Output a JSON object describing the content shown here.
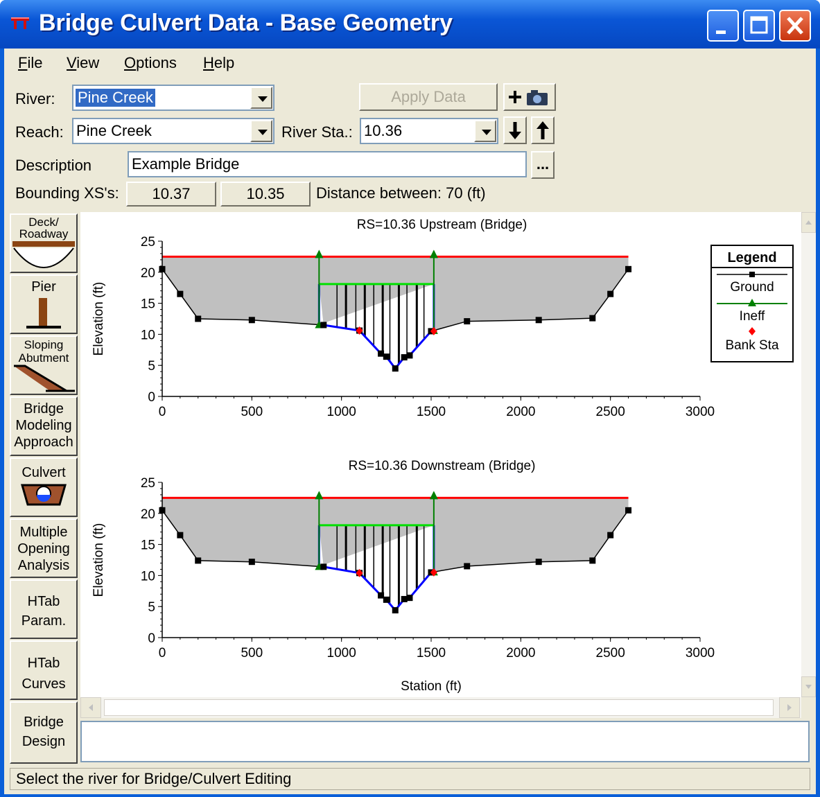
{
  "window": {
    "title": "Bridge Culvert Data - Base Geometry"
  },
  "menu": [
    {
      "label": "File",
      "mnemonic": "F"
    },
    {
      "label": "View",
      "mnemonic": "V"
    },
    {
      "label": "Options",
      "mnemonic": "O"
    },
    {
      "label": "Help",
      "mnemonic": "H"
    }
  ],
  "form": {
    "river_label": "River:",
    "river_value": "Pine Creek",
    "apply_label": "Apply Data",
    "reach_label": "Reach:",
    "reach_value": "Pine Creek",
    "river_sta_label": "River Sta.:",
    "river_sta_value": "10.36",
    "description_label": "Description",
    "description_value": "Example Bridge",
    "description_more": "...",
    "bounding_label": "Bounding XS's:",
    "bounding_up": "10.37",
    "bounding_down": "10.35",
    "distance_text": "Distance between: 70 (ft)"
  },
  "sidebar": [
    {
      "name": "deck-roadway",
      "lines": [
        "Deck/",
        "Roadway"
      ]
    },
    {
      "name": "pier",
      "lines": [
        "Pier"
      ]
    },
    {
      "name": "sloping-abutment",
      "lines": [
        "Sloping",
        "Abutment"
      ]
    },
    {
      "name": "bridge-modeling-approach",
      "lines": [
        "Bridge",
        "Modeling",
        "Approach"
      ]
    },
    {
      "name": "culvert",
      "lines": [
        "Culvert"
      ]
    },
    {
      "name": "multiple-opening-analysis",
      "lines": [
        "Multiple",
        "Opening",
        "Analysis"
      ]
    },
    {
      "name": "htab-param",
      "lines": [
        "HTab",
        "Param."
      ]
    },
    {
      "name": "htab-curves",
      "lines": [
        "HTab",
        "Curves"
      ]
    },
    {
      "name": "bridge-design",
      "lines": [
        "Bridge",
        "Design"
      ]
    }
  ],
  "colors": {
    "ground": "#000000",
    "ineff": "#008000",
    "bank": "#ff0000",
    "deck_top": "#ff0000",
    "low_chord": "#00e000",
    "bridge_outline": "#0000ff",
    "fill": "#c0c0c0"
  },
  "legend": {
    "title": "Legend",
    "items": [
      "Ground",
      "Ineff",
      "Bank Sta"
    ]
  },
  "chart_data": [
    {
      "type": "line",
      "title": "RS=10.36   Upstream  (Bridge)",
      "xlabel": "",
      "ylabel": "Elevation (ft)",
      "xlim": [
        0,
        3000
      ],
      "ylim": [
        0,
        25
      ],
      "xticks": [
        0,
        500,
        1000,
        1500,
        2000,
        2500,
        3000
      ],
      "yticks": [
        0,
        5,
        10,
        15,
        20,
        25
      ],
      "ground": {
        "x": [
          0,
          100,
          200,
          500,
          900,
          1100,
          1220,
          1250,
          1300,
          1350,
          1380,
          1500,
          1700,
          2100,
          2400,
          2500,
          2600
        ],
        "y": [
          20.5,
          16.5,
          12.5,
          12.3,
          11.5,
          10.6,
          6.9,
          6.4,
          4.5,
          6.3,
          6.6,
          10.5,
          12.1,
          12.3,
          12.6,
          16.5,
          20.5
        ]
      },
      "ineff": {
        "x": [
          875,
          1515
        ],
        "y": [
          22.5,
          22.5
        ]
      },
      "bank": {
        "x": [
          1100,
          1515
        ],
        "y": [
          10.6,
          10.5
        ]
      },
      "deck_top": 22.5,
      "low_chord": 18.1,
      "bridge_left": 875,
      "bridge_right": 1515,
      "pile_x": [
        975,
        1025,
        1080,
        1130,
        1180,
        1230,
        1270,
        1320,
        1365,
        1420,
        1460
      ]
    },
    {
      "type": "line",
      "title": "RS=10.36   Downstream  (Bridge)",
      "xlabel": "Station (ft)",
      "ylabel": "Elevation (ft)",
      "xlim": [
        0,
        3000
      ],
      "ylim": [
        0,
        25
      ],
      "xticks": [
        0,
        500,
        1000,
        1500,
        2000,
        2500,
        3000
      ],
      "yticks": [
        0,
        5,
        10,
        15,
        20,
        25
      ],
      "ground": {
        "x": [
          0,
          100,
          200,
          500,
          900,
          1100,
          1220,
          1250,
          1300,
          1350,
          1380,
          1500,
          1700,
          2100,
          2400,
          2500,
          2600
        ],
        "y": [
          20.5,
          16.5,
          12.4,
          12.2,
          11.4,
          10.4,
          6.8,
          6.1,
          4.4,
          6.2,
          6.4,
          10.5,
          11.5,
          12.2,
          12.4,
          16.5,
          20.5
        ]
      },
      "ineff": {
        "x": [
          875,
          1515
        ],
        "y": [
          22.5,
          22.5
        ]
      },
      "bank": {
        "x": [
          1100,
          1515
        ],
        "y": [
          10.4,
          10.5
        ]
      },
      "deck_top": 22.5,
      "low_chord": 18.1,
      "bridge_left": 875,
      "bridge_right": 1515,
      "pile_x": [
        975,
        1025,
        1080,
        1130,
        1180,
        1230,
        1270,
        1320,
        1365,
        1420,
        1460
      ]
    }
  ],
  "status": "Select the river for Bridge/Culvert Editing"
}
